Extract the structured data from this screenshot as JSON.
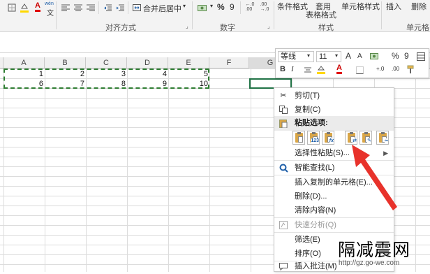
{
  "ribbon": {
    "wen_label": "wén",
    "wen_sub": "文",
    "merge_label": "合并后居中",
    "percent": "%",
    "comma": "9",
    "cond_format": "条件格式",
    "table_format_top": "套用",
    "table_format_bottom": "表格格式",
    "cell_style": "单元格样式",
    "insert": "插入",
    "delete": "删除",
    "group_alignment": "对齐方式",
    "group_number": "数字",
    "group_style": "样式",
    "group_cells": "单元格"
  },
  "sheet": {
    "columns": [
      "A",
      "B",
      "C",
      "D",
      "E",
      "F",
      "G"
    ],
    "rows": [
      [
        "1",
        "2",
        "3",
        "4",
        "5"
      ],
      [
        "6",
        "7",
        "8",
        "9",
        "10"
      ]
    ]
  },
  "mini_toolbar": {
    "font": "等线",
    "size": "11",
    "grow": "A",
    "shrink": "A",
    "percent": "%",
    "comma": "9",
    "bold": "B",
    "italic": "I",
    "font_color": "A",
    "dec_inc": "+.0",
    "dec_dec": ".00",
    "format_painter_icon": "format-painter-icon"
  },
  "context_menu": {
    "cut": "剪切(T)",
    "copy": "复制(C)",
    "paste_options": "粘贴选项:",
    "paste_badges": [
      "",
      "123",
      "fx",
      "",
      "",
      ""
    ],
    "paste_special": "选择性粘贴(S)...",
    "smart_lookup": "智能查找(L)",
    "insert_copied": "插入复制的单元格(E)...",
    "delete": "删除(D)...",
    "clear": "清除内容(N)",
    "quick_analysis": "快速分析(Q)",
    "filter": "筛选(E)",
    "sort": "排序(O)",
    "insert_comment": "插入批注(M)"
  },
  "watermark": {
    "text": "隔减震网",
    "url": "http://gz.go-we.com"
  },
  "colors": {
    "accent_green": "#217346",
    "marquee": "#2e7d32",
    "arrow_red": "#e8322b"
  }
}
